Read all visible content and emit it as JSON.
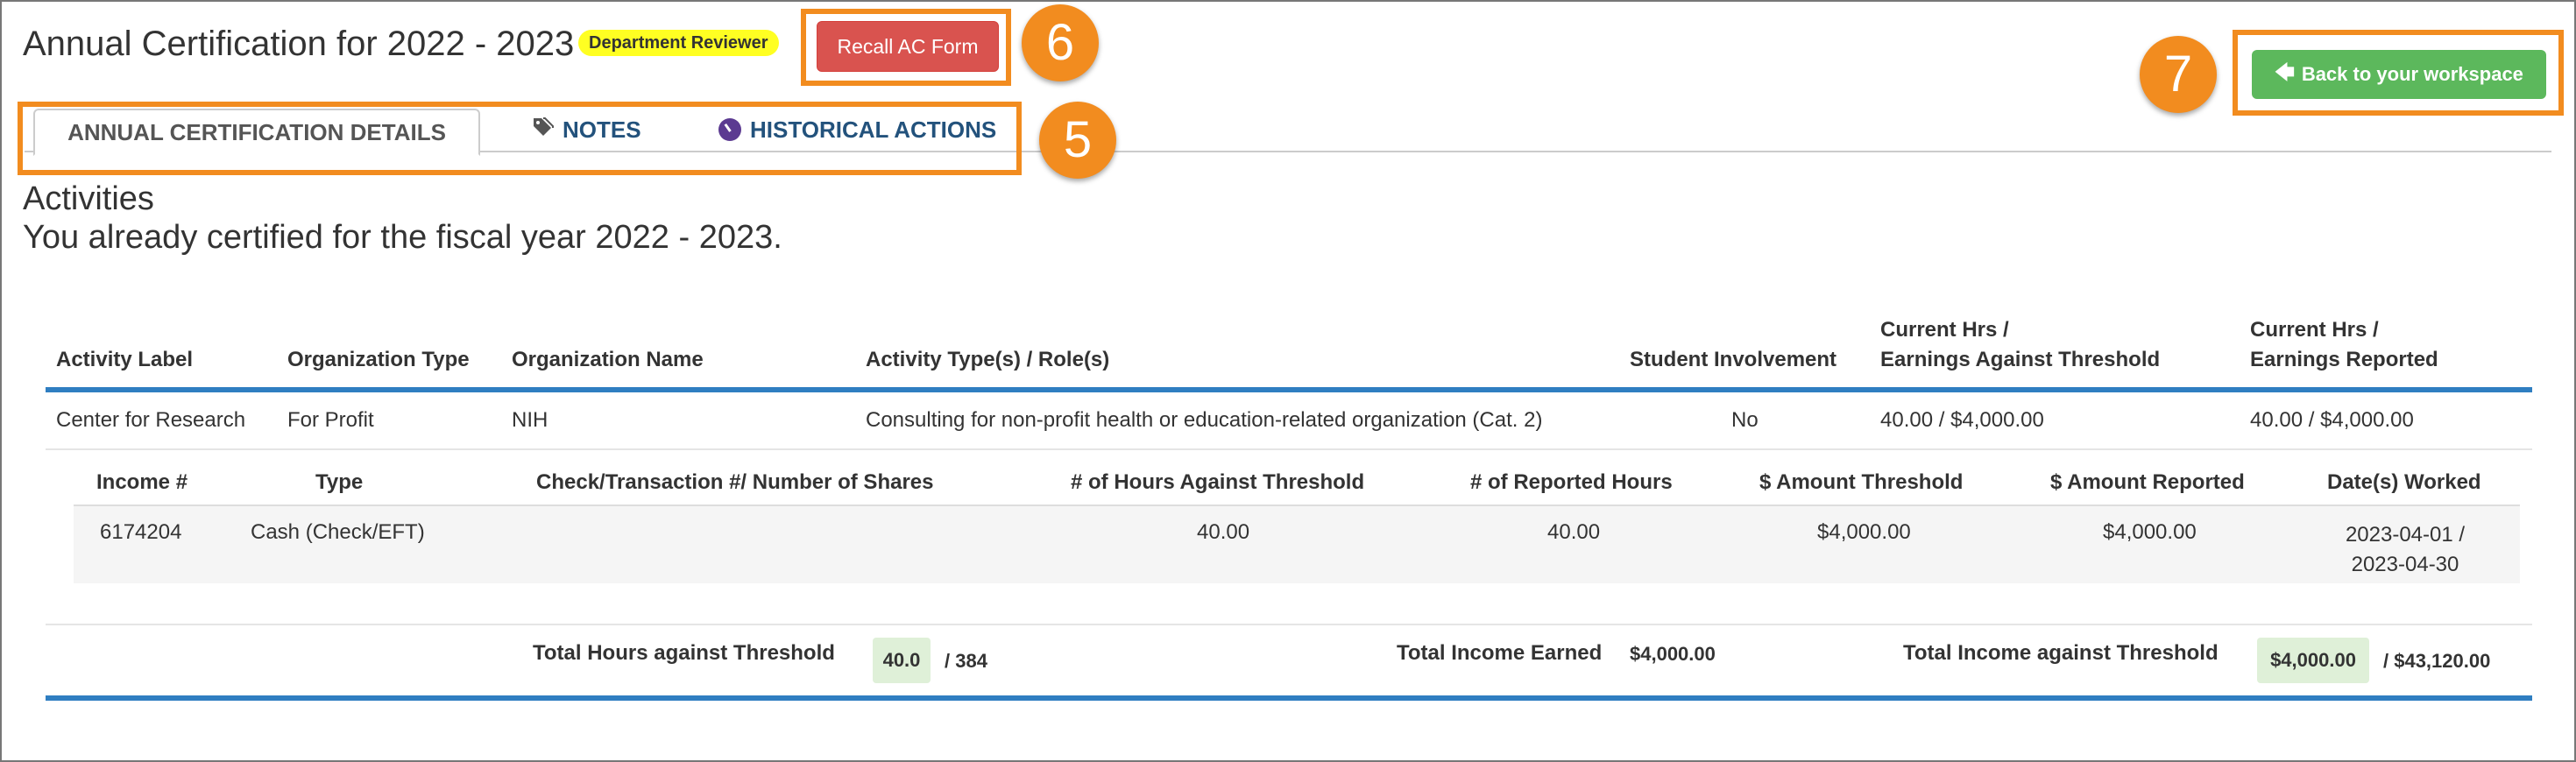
{
  "header": {
    "title": "Annual Certification for 2022 - 2023",
    "badge": "Department Reviewer",
    "recall_button": "Recall AC Form",
    "back_button": "Back to your workspace"
  },
  "callouts": [
    "6",
    "5",
    "7"
  ],
  "tabs": [
    {
      "label": "ANNUAL CERTIFICATION DETAILS",
      "icon": "none",
      "active": true
    },
    {
      "label": "NOTES",
      "icon": "tags-icon",
      "active": false
    },
    {
      "label": "HISTORICAL ACTIONS",
      "icon": "history-clock-icon",
      "active": false
    }
  ],
  "section": {
    "title": "Activities",
    "subtitle": "You already certified for the fiscal year 2022 - 2023."
  },
  "activities_table": {
    "headers": {
      "activity_label": "Activity Label",
      "organization_type": "Organization Type",
      "organization_name": "Organization Name",
      "activity_types": "Activity Type(s) / Role(s)",
      "student_involvement": "Student Involvement",
      "current_threshold_line1": "Current Hrs /",
      "current_threshold_line2": "Earnings Against Threshold",
      "current_reported_line1": "Current Hrs /",
      "current_reported_line2": "Earnings Reported"
    },
    "row": {
      "activity_label": "Center for Research",
      "organization_type": "For Profit",
      "organization_name": "NIH",
      "activity_types": "Consulting for non-profit health or education-related organization (Cat. 2)",
      "student_involvement": "No",
      "current_threshold": "40.00 / $4,000.00",
      "current_reported": "40.00 / $4,000.00"
    }
  },
  "income_table": {
    "headers": {
      "income_no": "Income #",
      "type": "Type",
      "check": "Check/Transaction #/ Number of Shares",
      "hours_threshold": "# of Hours Against Threshold",
      "reported_hours": "# of Reported Hours",
      "amount_threshold": "$ Amount Threshold",
      "amount_reported": "$ Amount Reported",
      "dates": "Date(s) Worked"
    },
    "row": {
      "income_no": "6174204",
      "type": "Cash (Check/EFT)",
      "check": "",
      "hours_threshold": "40.00",
      "reported_hours": "40.00",
      "amount_threshold": "$4,000.00",
      "amount_reported": "$4,000.00",
      "dates_line1": "2023-04-01 /",
      "dates_line2": "2023-04-30"
    }
  },
  "totals": {
    "hours_label": "Total Hours against Threshold",
    "hours_value": "40.0",
    "hours_max": "/ 384",
    "income_label": "Total Income Earned",
    "income_value": "$4,000.00",
    "threshold_label": "Total Income against Threshold",
    "threshold_value": "$4,000.00",
    "threshold_max": "/ $43,120.00"
  },
  "colors": {
    "recall": "#d9534f",
    "back": "#5cb85c",
    "callout": "#f28c1f",
    "badge": "#ffff22",
    "table_rule": "#2f7ec1",
    "total_highlight": "#dff0d8"
  }
}
